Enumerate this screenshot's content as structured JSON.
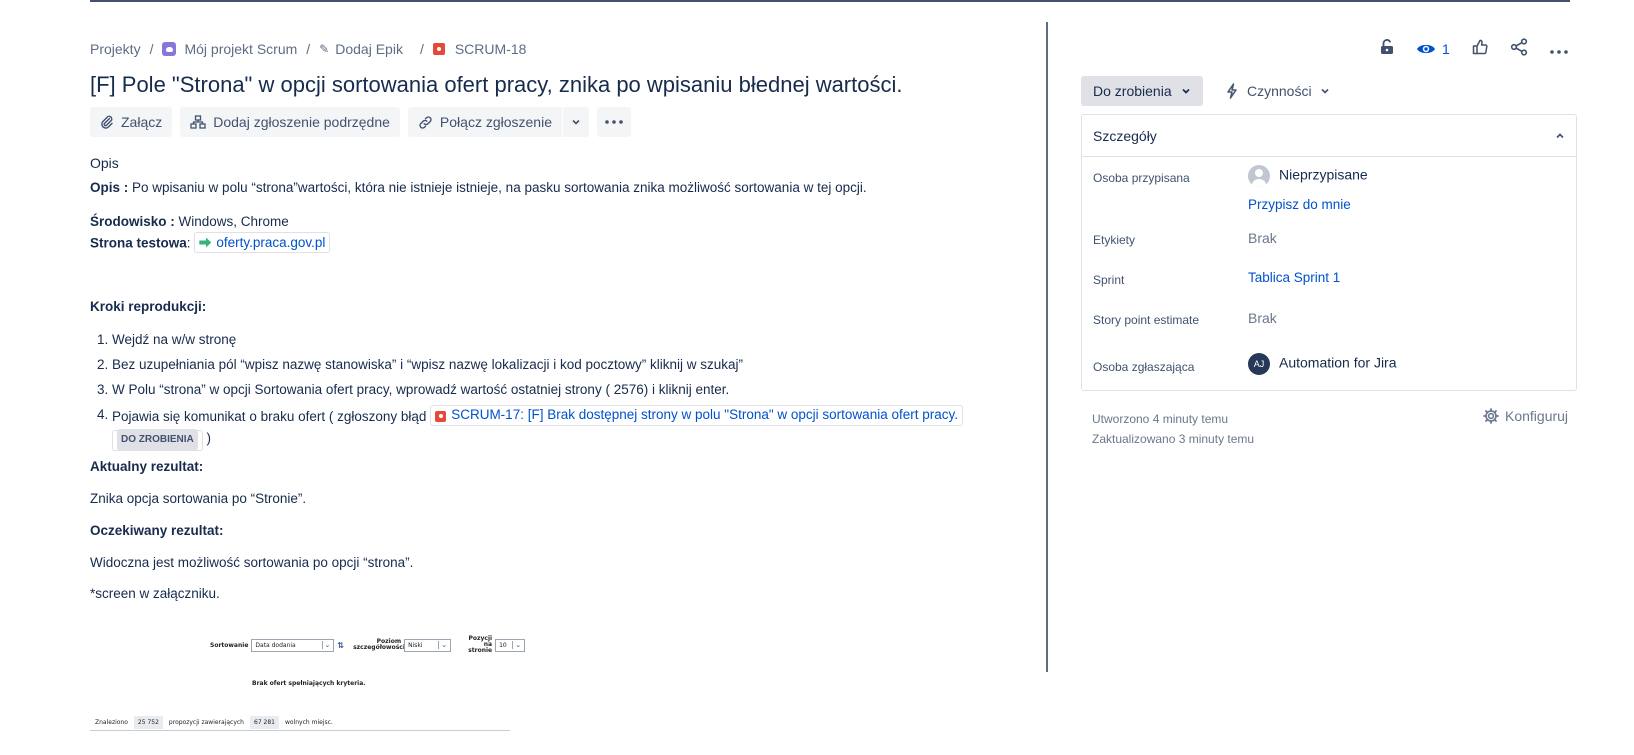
{
  "breadcrumb": {
    "projects": "Projekty",
    "project": "Mój projekt Scrum",
    "epic": "Dodaj Epik",
    "issue_key": "SCRUM-18"
  },
  "issue": {
    "title": "[F] Pole \"Strona\" w opcji sortowania ofert pracy, znika po wpisaniu błednej wartości."
  },
  "actions": {
    "attach": "Załącz",
    "add_child": "Dodaj zgłoszenie podrzędne",
    "link_issue": "Połącz zgłoszenie"
  },
  "description": {
    "heading": "Opis",
    "opis_label": "Opis :",
    "opis_text": " Po wpisaniu w polu “strona”wartości, która nie istnieje istnieje, na pasku sortowania znika możliwość sortowania w tej opcji.",
    "env_label": "Środowisko :",
    "env_text": " Windows, Chrome",
    "test_label": "Strona testowa",
    "test_sep": ":",
    "test_link": "oferty.praca.gov.pl",
    "steps_heading": "Kroki reprodukcji:",
    "steps": [
      {
        "num": "1.",
        "text": "Wejdź na w/w stronę"
      },
      {
        "num": "2.",
        "text": "Bez uzupełniania pól “wpisz nazwę stanowiska” i “wpisz nazwę lokalizacji i kod pocztowy” kliknij w szukaj”"
      },
      {
        "num": "3.",
        "text": "W Polu “strona” w opcji Sortowania ofert pracy, wprowadź wartość ostatniej strony ( 2576) i kliknij enter."
      }
    ],
    "step4_num": "4.",
    "step4_text": "Pojawia się komunikat o braku ofert ( zgłoszony błąd",
    "step4_link": "SCRUM-17: [F] Brak dostępnej strony w polu \"Strona\" w opcji sortowania ofert pracy.",
    "step4_status": "DO ZROBIENIA",
    "step4_close": ")",
    "actual_heading": "Aktualny rezultat:",
    "actual_text": "Znika opcja sortowania po “Stronie”.",
    "expected_heading": "Oczekiwany rezultat:",
    "expected_text": "Widoczna jest możliwość sortowania po opcji “strona”.",
    "screen_note": "*screen w załączniku."
  },
  "screenshot_attachment": {
    "sort_label": "Sortowanie",
    "sort_value": "Data dodania",
    "level_label": "Poziom szczegółowości",
    "level_value": "Niski",
    "per_page_label": "Pozycji na stronie",
    "per_page_value": "10",
    "no_results": "Brak ofert spełniających kryteria.",
    "found_label": "Znaleziono",
    "found_count": "25 752",
    "proposals_label": "propozycji zawierających",
    "jobs_count": "67 281",
    "jobs_label": "wolnych miejsc."
  },
  "header_tools": {
    "watchers": "1"
  },
  "status": {
    "current": "Do zrobienia",
    "actions_label": "Czynności"
  },
  "details": {
    "heading": "Szczegóły",
    "assignee_label": "Osoba przypisana",
    "assignee_value": "Nieprzypisane",
    "assign_to_me": "Przypisz do mnie",
    "labels_label": "Etykiety",
    "labels_value": "Brak",
    "sprint_label": "Sprint",
    "sprint_value": "Tablica Sprint 1",
    "sp_label": "Story point estimate",
    "sp_value": "Brak",
    "reporter_label": "Osoba zgłaszająca",
    "reporter_initials": "AJ",
    "reporter_value": "Automation for Jira"
  },
  "meta": {
    "created": "Utworzono 4 minuty temu",
    "updated": "Zaktualizowano 3 minuty temu",
    "configure": "Konfiguruj"
  },
  "colors": {
    "link": "#0052cc",
    "bug": "#e5493a",
    "project": "#8777d9",
    "text": "#172b4d"
  }
}
